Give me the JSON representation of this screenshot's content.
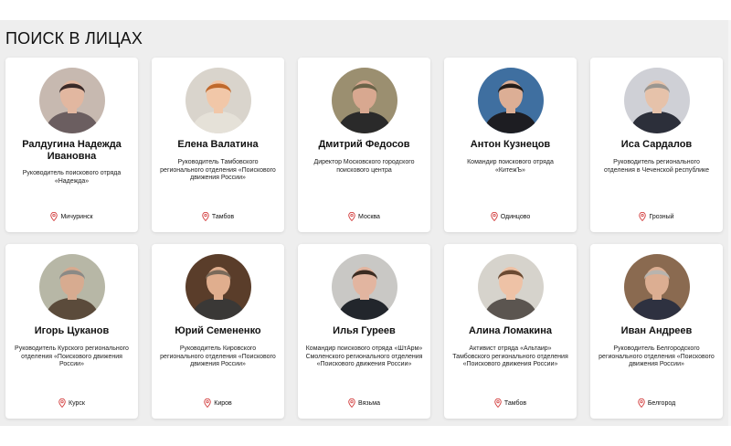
{
  "section": {
    "title": "ПОИСК В ЛИЦАХ"
  },
  "colors": {
    "accent": "#d23c3c",
    "card_bg": "#ffffff",
    "page_bg": "#eeeeee"
  },
  "people": [
    {
      "name": "Ралдугина Надежда Ивановна",
      "role": "Руководитель поискового отряда «Надежда»",
      "location": "Мичуринск",
      "photo": {
        "bg": "#c7b9b0",
        "skin": "#e2b7a0",
        "hair": "#3a2a28",
        "shirt": "#6b5e60"
      }
    },
    {
      "name": "Елена Валатина",
      "role": "Руководитель Тамбовского регионального отделения «Поискового движения России»",
      "location": "Тамбов",
      "photo": {
        "bg": "#d9d4cc",
        "skin": "#f1c7a8",
        "hair": "#c0692c",
        "shirt": "#e5e1d8"
      }
    },
    {
      "name": "Дмитрий Федосов",
      "role": "Директор Московского городского поискового центра",
      "location": "Москва",
      "photo": {
        "bg": "#9b8f70",
        "skin": "#d8a890",
        "hair": "#6a6348",
        "shirt": "#2a2a2a"
      }
    },
    {
      "name": "Антон Кузнецов",
      "role": "Командир поискового отряда «КитежЪ»",
      "location": "Одинцово",
      "photo": {
        "bg": "#3f6fa0",
        "skin": "#dcae95",
        "hair": "#241c18",
        "shirt": "#1d1d22"
      }
    },
    {
      "name": "Иса Сардалов",
      "role": "Руководитель регионального отделения в Чеченской республике",
      "location": "Грозный",
      "photo": {
        "bg": "#cfd0d6",
        "skin": "#e6c2aa",
        "hair": "#9a9690",
        "shirt": "#2c2f3a"
      }
    },
    {
      "name": "Игорь Цуканов",
      "role": "Руководитель Курского регионального отделения «Поискового движения России»",
      "location": "Курск",
      "photo": {
        "bg": "#b7b7a6",
        "skin": "#d7ab90",
        "hair": "#8b8a86",
        "shirt": "#5b4b3b"
      }
    },
    {
      "name": "Юрий Семененко",
      "role": "Руководитель Кировского регионального отделения «Поискового движения России»",
      "location": "Киров",
      "photo": {
        "bg": "#5a3d2a",
        "skin": "#e0ae8e",
        "hair": "#7a6a5a",
        "shirt": "#3a3836"
      }
    },
    {
      "name": "Илья Гуреев",
      "role": "Командир поискового отряда «ШтАрм» Смоленского регионального отделения «Поискового движения России»",
      "location": "Вязьма",
      "photo": {
        "bg": "#c9c8c5",
        "skin": "#e2b5a0",
        "hair": "#3b2c22",
        "shirt": "#22262c"
      }
    },
    {
      "name": "Алина Ломакина",
      "role": "Активист отряда «Альтаир» Тамбовского регионального отделения «Поискового движения России»",
      "location": "Тамбов",
      "photo": {
        "bg": "#d6d3cc",
        "skin": "#eec2a6",
        "hair": "#6b4a32",
        "shirt": "#5b5550"
      }
    },
    {
      "name": "Иван Андреев",
      "role": "Руководитель Белгородского регионального отделения «Поискового движения России»",
      "location": "Белгород",
      "photo": {
        "bg": "#8a6a50",
        "skin": "#dcae92",
        "hair": "#b8b4ae",
        "shirt": "#2e3140"
      }
    }
  ]
}
